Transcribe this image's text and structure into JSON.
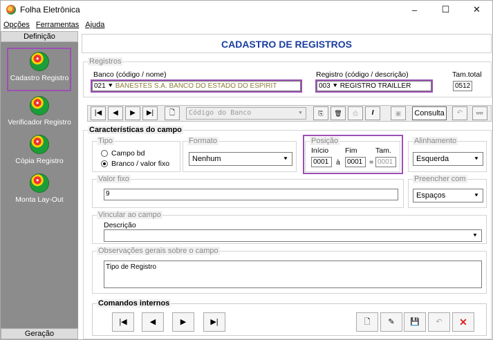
{
  "window": {
    "title": "Folha Eletrônica",
    "minimize": "–",
    "maximize": "☐",
    "close": "✕"
  },
  "menu": {
    "opcoes": "Opções",
    "ferramentas": "Ferramentas",
    "ajuda": "Ajuda"
  },
  "sidebar": {
    "header": "Definição",
    "footer": "Geração",
    "items": [
      {
        "label": "Cadastro Registro"
      },
      {
        "label": "Verificador Registro"
      },
      {
        "label": "Cópia Registro"
      },
      {
        "label": "Monta Lay-Out"
      }
    ]
  },
  "main": {
    "title": "CADASTRO DE REGISTROS"
  },
  "registros": {
    "legend": "Registros",
    "banco_label": "Banco (código / nome)",
    "banco_code": "021",
    "banco_name": "BANESTES S.A. BANCO DO ESTADO DO ESPIRIT",
    "registro_label": "Registro (código / descrição)",
    "registro_code": "003",
    "registro_desc": "REGISTRO TRAILLER",
    "tam_label": "Tam.total",
    "tam_value": "0512"
  },
  "toolbar": {
    "first": "|◀",
    "prev": "◀",
    "next": "▶",
    "last": "▶|",
    "new": "🗋",
    "search_placeholder": "Código do Banco",
    "consulta": "Consulta",
    "undo": "↶",
    "find": "🔍"
  },
  "caracteristicas": {
    "legend": "Características do campo",
    "tipo": {
      "legend": "Tipo",
      "opt1": "Campo bd",
      "opt2": "Branco / valor fixo"
    },
    "formato": {
      "legend": "Formato",
      "value": "Nenhum"
    },
    "posicao": {
      "legend": "Posição",
      "inicio_label": "Início",
      "fim_label": "Fim",
      "tam_label": "Tam.",
      "inicio": "0001",
      "a": "à",
      "fim": "0001",
      "eq": "=",
      "tam": "0001"
    },
    "alinhamento": {
      "legend": "Alinhamento",
      "value": "Esquerda"
    },
    "valor_fixo": {
      "legend": "Valor fixo",
      "value": "9"
    },
    "preencher": {
      "legend": "Preencher com",
      "value": "Espaços"
    },
    "vincular": {
      "legend": "Vincular ao campo",
      "descricao_label": "Descrição",
      "value": ""
    },
    "observacoes": {
      "legend": "Observações gerais sobre o campo",
      "value": "Tipo de Registro"
    }
  },
  "comandos": {
    "legend": "Comandos internos",
    "first": "|◀",
    "prev": "◀",
    "next": "▶",
    "last": "▶|",
    "new": "🗋",
    "edit": "✎",
    "save": "💾",
    "undo": "↶",
    "cancel": "✕"
  }
}
